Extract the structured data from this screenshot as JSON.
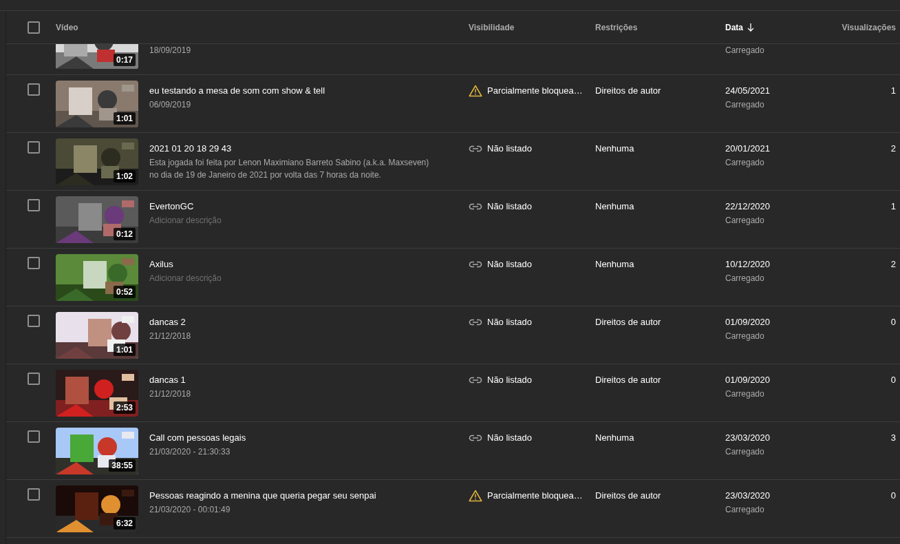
{
  "header": {
    "checked": false,
    "columns": [
      {
        "label": "Vídeo",
        "sorted": false
      },
      {
        "label": "Visibilidade",
        "sorted": false
      },
      {
        "label": "Restrições",
        "sorted": false
      },
      {
        "label": "Data",
        "sorted": true
      },
      {
        "label": "Visualizações",
        "sorted": false
      }
    ]
  },
  "partial_row": {
    "description": "18/09/2019",
    "duration": "0:17",
    "date_status": "Carregado"
  },
  "rows": [
    {
      "checked": false,
      "duration": "1:01",
      "title": "eu testando a mesa de som com show & tell",
      "description": "06/09/2019",
      "description_empty": false,
      "visibility": {
        "kind": "warning",
        "label": "Parcialmente bloquea…"
      },
      "restrictions": "Direitos de autor",
      "date": "24/05/2021",
      "date_status": "Carregado",
      "views": "1"
    },
    {
      "checked": false,
      "duration": "1:02",
      "title": "2021 01 20 18 29 43",
      "description": "Esta jogada foi feita por Lenon Maximiano Barreto Sabino (a.k.a. Maxseven) no dia de 19 de Janeiro de 2021 por volta das 7 horas da noite.",
      "description_empty": false,
      "visibility": {
        "kind": "link",
        "label": "Não listado"
      },
      "restrictions": "Nenhuma",
      "date": "20/01/2021",
      "date_status": "Carregado",
      "views": "2"
    },
    {
      "checked": false,
      "duration": "0:12",
      "title": "EvertonGC",
      "description": "Adicionar descrição",
      "description_empty": true,
      "visibility": {
        "kind": "link",
        "label": "Não listado"
      },
      "restrictions": "Nenhuma",
      "date": "22/12/2020",
      "date_status": "Carregado",
      "views": "1"
    },
    {
      "checked": false,
      "duration": "0:52",
      "title": "Axilus",
      "description": "Adicionar descrição",
      "description_empty": true,
      "visibility": {
        "kind": "link",
        "label": "Não listado"
      },
      "restrictions": "Nenhuma",
      "date": "10/12/2020",
      "date_status": "Carregado",
      "views": "2"
    },
    {
      "checked": false,
      "duration": "1:01",
      "title": "dancas 2",
      "description": "21/12/2018",
      "description_empty": false,
      "visibility": {
        "kind": "link",
        "label": "Não listado"
      },
      "restrictions": "Direitos de autor",
      "date": "01/09/2020",
      "date_status": "Carregado",
      "views": "0"
    },
    {
      "checked": false,
      "duration": "2:53",
      "title": "dancas 1",
      "description": "21/12/2018",
      "description_empty": false,
      "visibility": {
        "kind": "link",
        "label": "Não listado"
      },
      "restrictions": "Direitos de autor",
      "date": "01/09/2020",
      "date_status": "Carregado",
      "views": "0"
    },
    {
      "checked": false,
      "duration": "38:55",
      "title": "Call com pessoas legais",
      "description": "21/03/2020 - 21:30:33",
      "description_empty": false,
      "visibility": {
        "kind": "link",
        "label": "Não listado"
      },
      "restrictions": "Nenhuma",
      "date": "23/03/2020",
      "date_status": "Carregado",
      "views": "3"
    },
    {
      "checked": false,
      "duration": "6:32",
      "title": "Pessoas reagindo a menina que queria pegar seu senpai",
      "description": "21/03/2020 - 00:01:49",
      "description_empty": false,
      "visibility": {
        "kind": "warning",
        "label": "Parcialmente bloquea…"
      },
      "restrictions": "Direitos de autor",
      "date": "23/03/2020",
      "date_status": "Carregado",
      "views": "0"
    }
  ]
}
